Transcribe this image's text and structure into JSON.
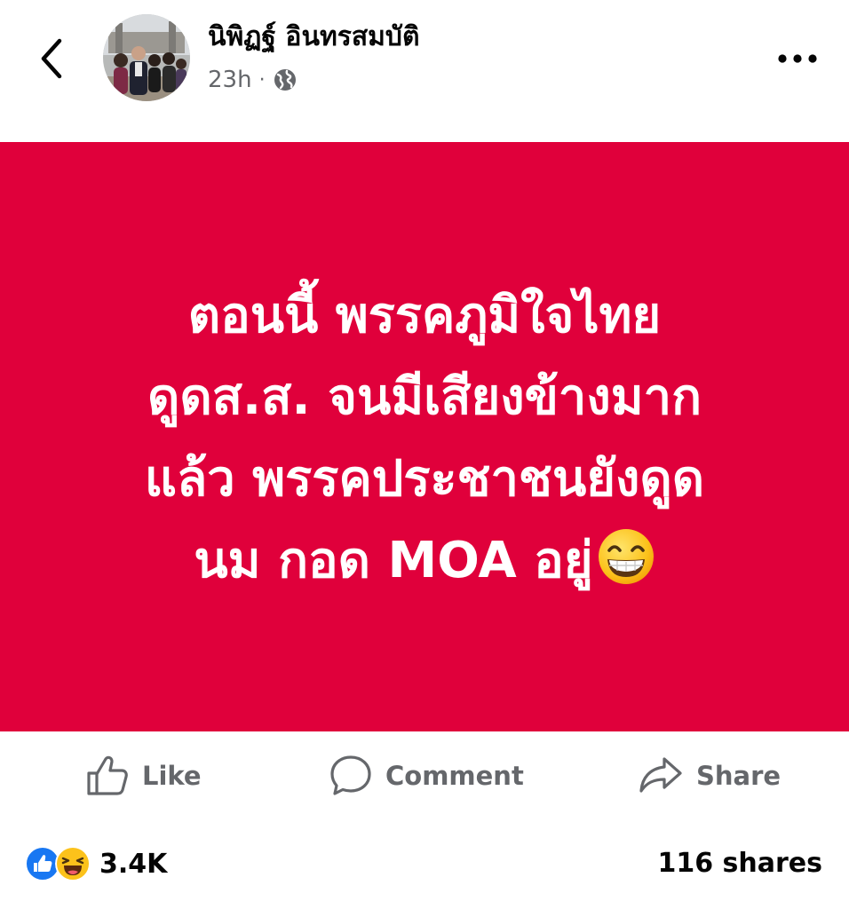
{
  "header": {
    "back_icon": "chevron-left-icon",
    "author_name": "นิพิฏฐ์ อินทรสมบัติ",
    "time_ago": "23h",
    "separator": "·",
    "audience_icon": "globe-icon",
    "more_icon": "ellipsis-icon"
  },
  "post": {
    "background_color": "#e0003b",
    "text_color": "#ffffff",
    "lines": [
      "ตอนนี้ พรรคภูมิใจไทย",
      "ดูดส.ส. จนมีเสียงข้างมาก",
      "แล้ว พรรคประชาชนยังดูด",
      "นม กอด MOA อยู่"
    ],
    "trailing_emoji": "grinning-face-with-smiling-eyes"
  },
  "actions": {
    "like_label": "Like",
    "comment_label": "Comment",
    "share_label": "Share"
  },
  "stats": {
    "reaction_icons": [
      "like-reaction-icon",
      "haha-reaction-icon"
    ],
    "reaction_count": "3.4K",
    "shares": "116 shares"
  },
  "colors": {
    "accent_blue": "#1877f2",
    "muted_text": "#65676b"
  }
}
